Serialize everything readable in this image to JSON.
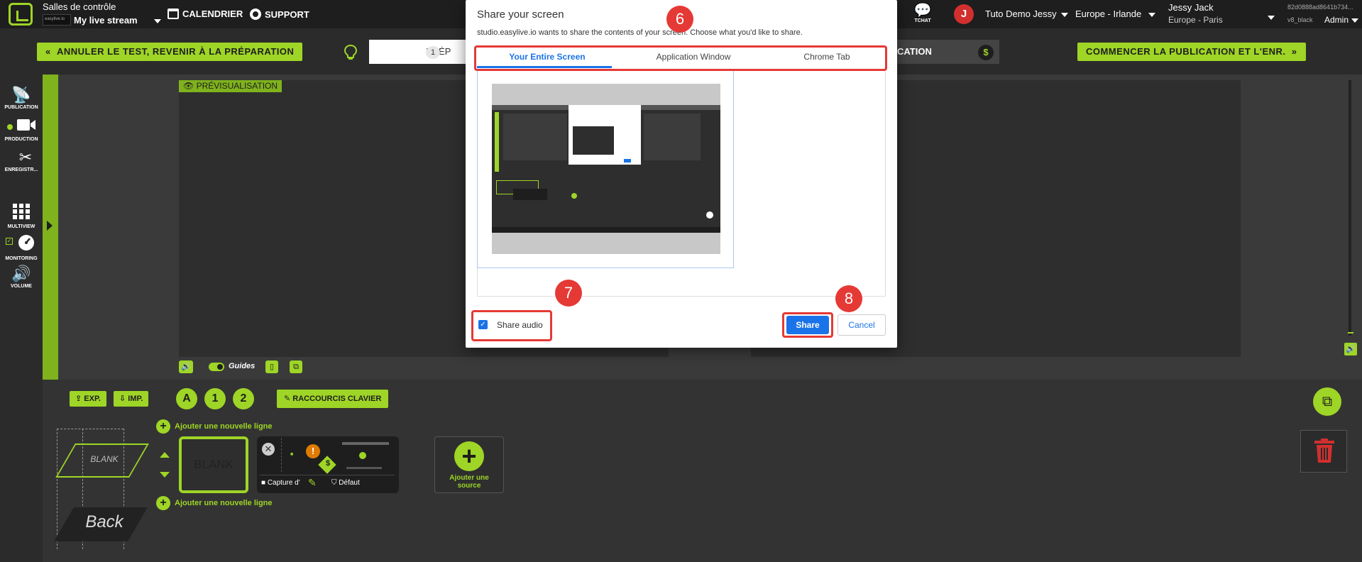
{
  "topbar": {
    "control_rooms_label": "Salles de contrôle",
    "stream_name": "My live stream",
    "mini_thumb_text": "easylive.io",
    "calendar": "CALENDRIER",
    "support": "SUPPORT",
    "chat": "TCHAT",
    "avatar_letter": "J",
    "account": "Tuto Demo Jessy",
    "region": "Europe - Irlande",
    "user_name": "Jessy Jack",
    "user_tz": "Europe - Paris",
    "build_id": "82d0888ad8641b734...",
    "build_channel": "v8_black",
    "role": "Admin"
  },
  "actions": {
    "cancel_test": "ANNULER LE TEST, REVENIR À LA PRÉPARATION",
    "step_number": "1",
    "step_prep": "PRÉP",
    "step_publication": "CATION",
    "dollar": "$",
    "start_publish": "COMMENCER LA PUBLICATION ET L'ENR."
  },
  "sidebar": {
    "publication": "PUBLICATION",
    "production": "PRODUCTION",
    "recording": "ENREGISTR...",
    "multiview": "MULTIVIEW",
    "monitoring": "MONITORING",
    "volume": "VOLUME"
  },
  "preview": {
    "label": "PRÉVISUALISATION",
    "guides": "Guides"
  },
  "bottom": {
    "export": "EXP.",
    "import": "IMP.",
    "layer_a": "A",
    "layer_1": "1",
    "layer_2": "2",
    "shortcuts": "RACCOURCIS CLAVIER",
    "add_line_top": "Ajouter une nouvelle ligne",
    "add_line_bottom": "Ajouter une nouvelle ligne",
    "blank_para": "BLANK",
    "back": "Back",
    "blank_tile": "BLANK",
    "tile_capture": "Capture d'",
    "tile_default": "Défaut",
    "add_source_line1": "Ajouter une",
    "add_source_line2": "source"
  },
  "modal": {
    "title": "Share your screen",
    "description": "studio.easylive.io wants to share the contents of your screen. Choose what you'd like to share.",
    "tabs": [
      {
        "label": "Your Entire Screen",
        "active": true
      },
      {
        "label": "Application Window",
        "active": false
      },
      {
        "label": "Chrome Tab",
        "active": false
      }
    ],
    "share_audio": "Share audio",
    "share": "Share",
    "cancel": "Cancel"
  },
  "annotations": {
    "six": "6",
    "seven": "7",
    "eight": "8"
  },
  "colors": {
    "accent": "#9ed526",
    "dark": "#1e1e1e",
    "blue": "#1a73e8",
    "annotation_red": "#e53935"
  }
}
